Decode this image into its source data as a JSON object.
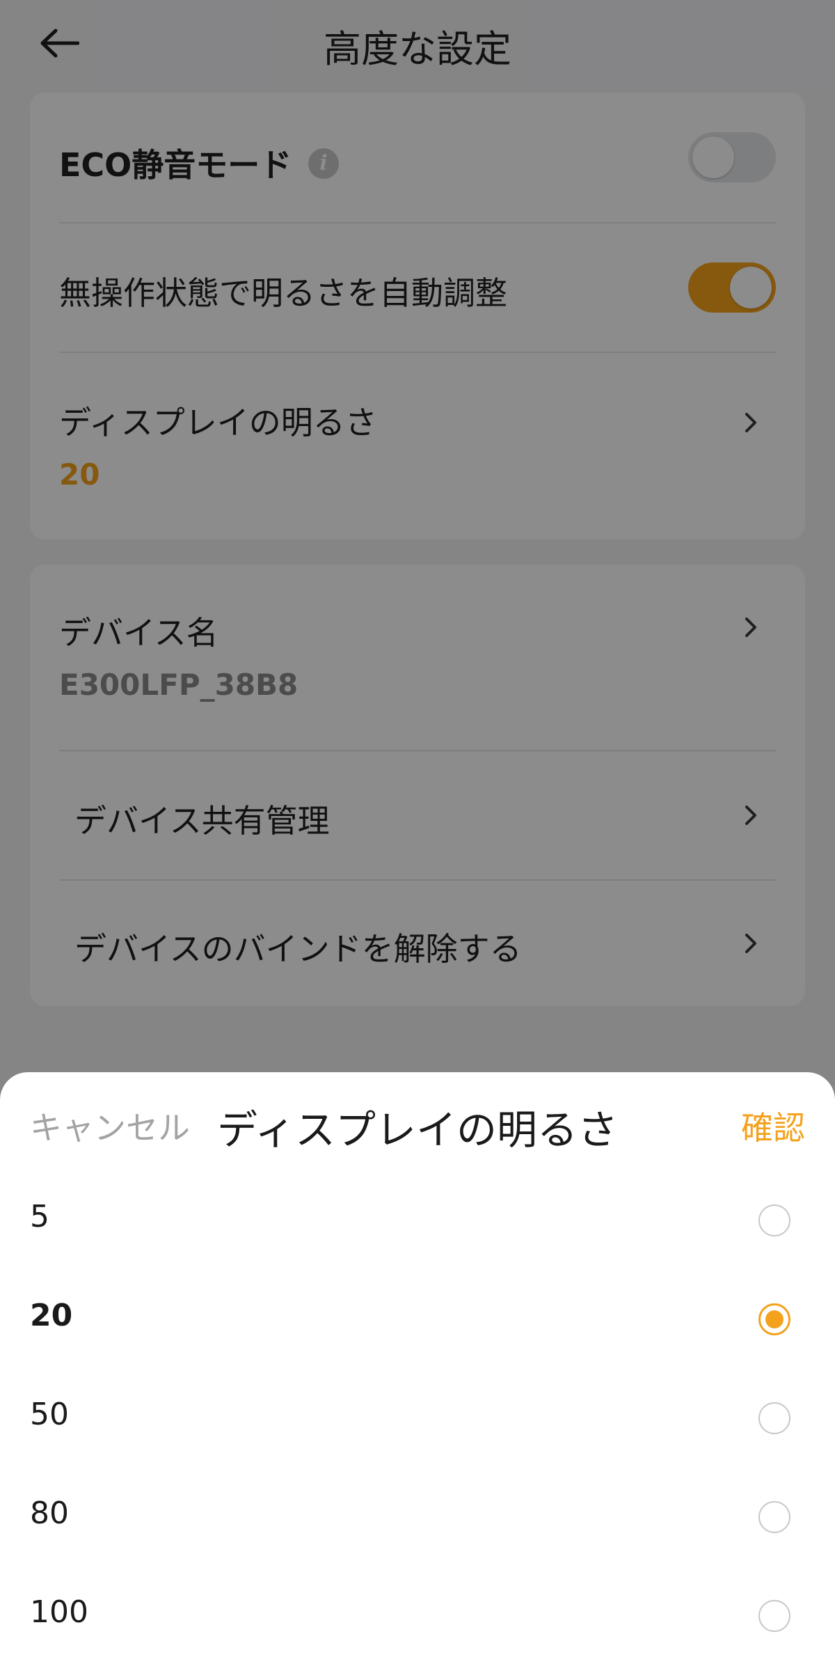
{
  "header": {
    "title": "高度な設定",
    "back_icon": "arrow-left-icon"
  },
  "settings": {
    "eco_mode": {
      "label": "ECO静音モード",
      "info": "i",
      "enabled": false
    },
    "auto_brightness": {
      "label": "無操作状態で明るさを自動調整",
      "enabled": true
    },
    "display_brightness": {
      "label": "ディスプレイの明るさ",
      "value": "20"
    },
    "device_name": {
      "label": "デバイス名",
      "value": "E300LFP_38B8"
    },
    "device_sharing": {
      "label": "デバイス共有管理"
    },
    "unbind_device": {
      "label": "デバイスのバインドを解除する"
    }
  },
  "sheet": {
    "cancel_label": "キャンセル",
    "title": "ディスプレイの明るさ",
    "confirm_label": "確認",
    "options": [
      {
        "label": "5",
        "selected": false
      },
      {
        "label": "20",
        "selected": true
      },
      {
        "label": "50",
        "selected": false
      },
      {
        "label": "80",
        "selected": false
      },
      {
        "label": "100",
        "selected": false
      }
    ]
  },
  "colors": {
    "accent": "#f4a21d",
    "background": "#f2f3f5",
    "card": "#ffffff",
    "overlay": "rgba(0,0,0,0.45)"
  }
}
